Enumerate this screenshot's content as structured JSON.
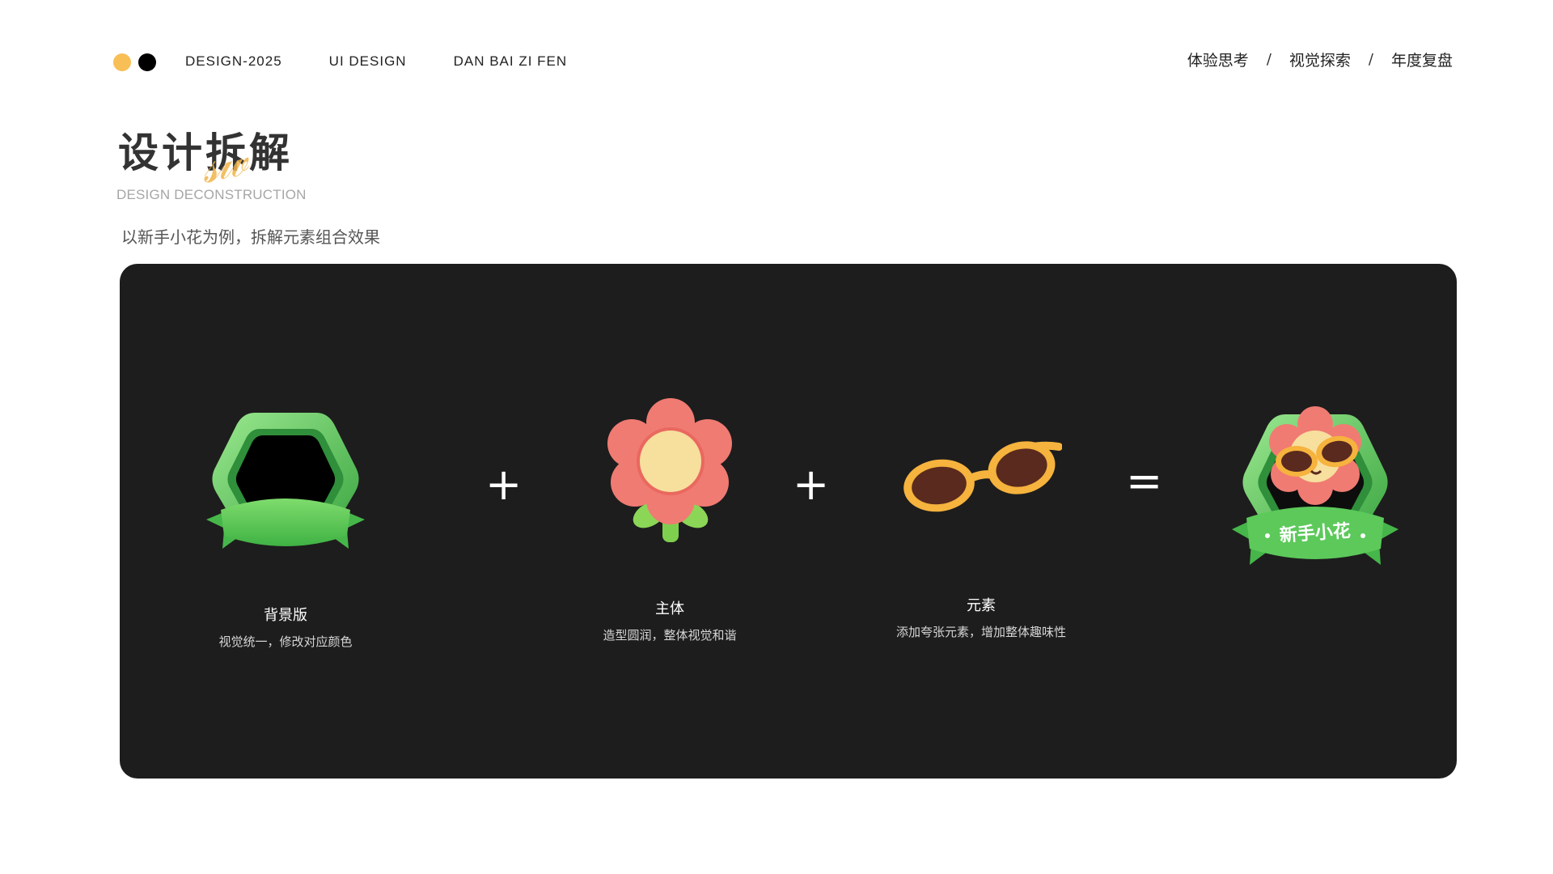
{
  "header": {
    "dots": [
      "#f8bf57",
      "#000000"
    ],
    "nav_left": [
      "DESIGN-2025",
      "UI DESIGN",
      "DAN BAI ZI FEN"
    ],
    "nav_right": [
      "体验思考",
      "视觉探索",
      "年度复盘"
    ],
    "separator": "/"
  },
  "section": {
    "title": "设计拆解",
    "subtitle": "DESIGN DECONSTRUCTION",
    "intro": "以新手小花为例，拆解元素组合效果"
  },
  "panel": {
    "items": [
      {
        "title": "背景版",
        "desc": "视觉统一，修改对应颜色"
      },
      {
        "title": "主体",
        "desc": "造型圆润，整体视觉和谐"
      },
      {
        "title": "元素",
        "desc": "添加夸张元素，增加整体趣味性"
      }
    ],
    "plus": "+",
    "equals": "=",
    "result_badge_text": "新手小花",
    "colors": {
      "panel": "#1d1d1d",
      "green": "#5cc95a",
      "petal": "#f07b72",
      "center": "#f7df9e",
      "glasses": "#f6b33d"
    }
  }
}
